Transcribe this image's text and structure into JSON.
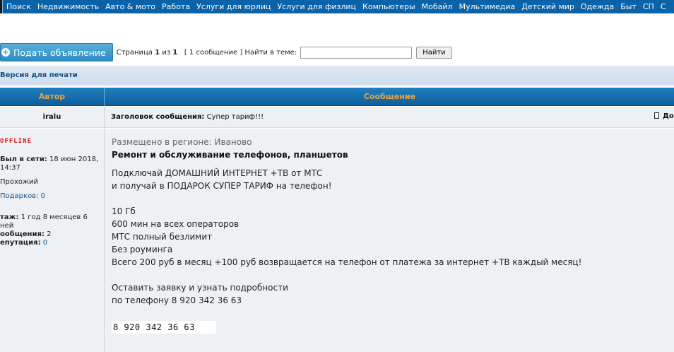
{
  "nav": {
    "items": [
      "Поиск",
      "Недвижимость",
      "Авто & мото",
      "Работа",
      "Услуги для юрлиц",
      "Услуги для физлиц",
      "Компьютеры",
      "Мобайл",
      "Мультимедиа",
      "Детский мир",
      "Одежда",
      "Быт",
      "СП",
      "С"
    ]
  },
  "toolbar": {
    "post_button": "Подать объявление",
    "page_label": "Страница",
    "page_current": "1",
    "page_of": "из",
    "page_total": "1",
    "messages_count": "[ 1 сообщение ]",
    "search_label": "Найти в теме:",
    "search_value": "",
    "search_button": "Найти"
  },
  "print_link": "Версия для печати",
  "table_header": {
    "author": "Автор",
    "message": "Сообщение"
  },
  "post": {
    "author": "iralu",
    "subject_label": "Заголовок сообщения:",
    "subject": "Супер тариф!!!",
    "edge_link": "До",
    "status": "OFFLINE",
    "profile": {
      "last_seen_label": "Был в сети:",
      "last_seen_value": "18 июн 2018, 14:37",
      "rank": "Прохожий",
      "gifts_label": "Подарков:",
      "gifts_value": "0",
      "tenure_label": "таж:",
      "tenure_value": "1 год 8 месяцев 6 ней",
      "messages_label": "ообщения:",
      "messages_value": "2",
      "reputation_label": "епутация:",
      "reputation_value": "0"
    },
    "region": "Размещено в регионе: Иваново",
    "title": "Ремонт и обслуживание телефонов, планшетов",
    "lines": [
      "Подключай ДОМАШНИЙ ИНТЕРНЕТ +ТВ от МТС",
      "и получай в ПОДАРОК СУПЕР ТАРИФ на телефон!",
      "",
      "10 Гб",
      "600 мин на всех операторов",
      "МТС полный безлимит",
      "Без роуминга",
      "Всего 200 руб в месяц +100 руб возвращается на телефон от платежа за интернет +ТВ каждый месяц!",
      "",
      "Оставить заявку и узнать подробности",
      "по телефону 8 920 342 36 63"
    ],
    "phone_box": "8 920 342 36 63"
  }
}
